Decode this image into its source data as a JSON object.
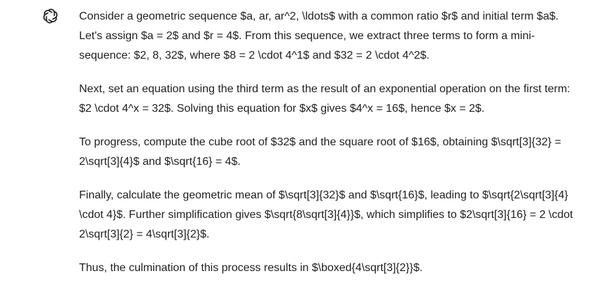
{
  "assistant": {
    "avatar_icon": "openai-logo-icon",
    "paragraphs": [
      "Consider a geometric sequence $a, ar, ar^2, \\ldots$ with a common ratio $r$ and initial term $a$. Let's assign $a = 2$ and $r = 4$. From this sequence, we extract three terms to form a mini-sequence: $2, 8, 32$, where $8 = 2 \\cdot 4^1$ and $32 = 2 \\cdot 4^2$.",
      "Next, set an equation using the third term as the result of an exponential operation on the first term: $2 \\cdot 4^x = 32$. Solving this equation for $x$ gives $4^x = 16$, hence $x = 2$.",
      "To progress, compute the cube root of $32$ and the square root of $16$, obtaining $\\sqrt[3]{32} = 2\\sqrt[3]{4}$ and $\\sqrt{16} = 4$.",
      "Finally, calculate the geometric mean of $\\sqrt[3]{32}$ and $\\sqrt{16}$, leading to $\\sqrt{2\\sqrt[3]{4} \\cdot 4}$. Further simplification gives $\\sqrt{8\\sqrt[3]{4}}$, which simplifies to $2\\sqrt[3]{16} = 2 \\cdot 2\\sqrt[3]{2} = 4\\sqrt[3]{2}$.",
      "Thus, the culmination of this process results in $\\boxed{4\\sqrt[3]{2}}$."
    ]
  }
}
